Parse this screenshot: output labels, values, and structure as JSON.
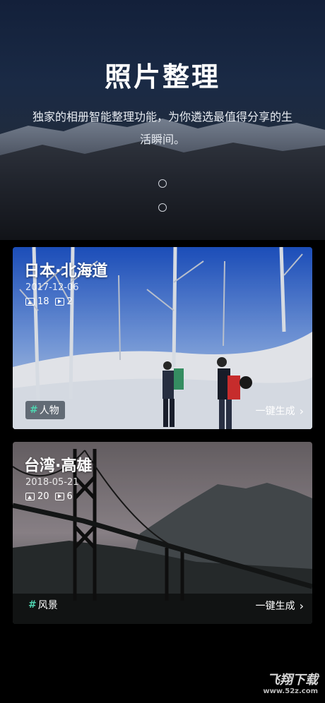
{
  "hero": {
    "title": "照片整理",
    "subtitle": "独家的相册智能整理功能，为你遴选最值得分享的生活瞬间。"
  },
  "cards": [
    {
      "title": "日本·北海道",
      "date": "2017-12-06",
      "photo_count": "18",
      "video_count": "2",
      "tag": "人物",
      "action": "一键生成"
    },
    {
      "title": "台湾·高雄",
      "date": "2018-05-21",
      "photo_count": "20",
      "video_count": "6",
      "tag": "风景",
      "action": "一键生成"
    }
  ],
  "watermark": {
    "brand": "飞翔下载",
    "url": "www.52z.com"
  },
  "colors": {
    "tag_hash": "#4fd4b0",
    "background": "#000000"
  }
}
